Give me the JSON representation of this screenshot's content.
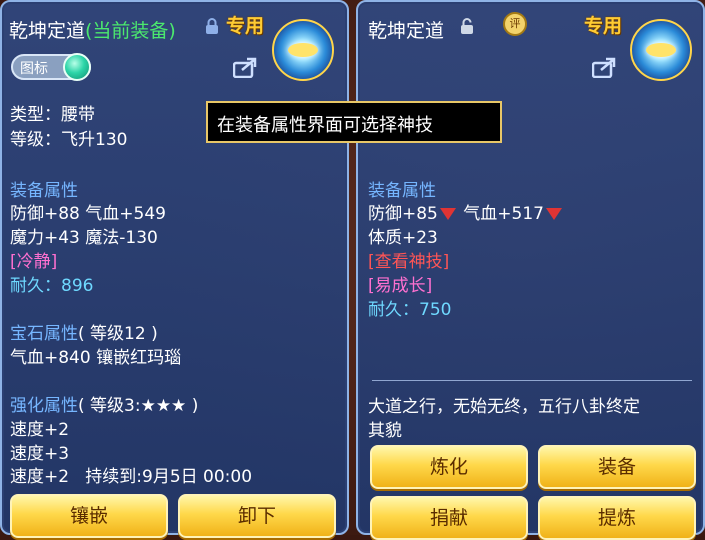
{
  "left": {
    "title_main": "乾坤定道",
    "title_status": "(当前装备)",
    "special_label": "专用",
    "icon_toggle_label": "图标",
    "type_line": "类型：腰带",
    "level_line": "等级：飞升130",
    "equip_attr_header": "装备属性",
    "attr_line1": "防御+88 气血+549",
    "attr_line2": "魔力+43 魔法-130",
    "special_tag": "[冷静]",
    "durability": "耐久：896",
    "gem_header": "宝石属性",
    "gem_level": "( 等级12 )",
    "gem_line": "气血+840 镶嵌红玛瑙",
    "enhance_header": "强化属性",
    "enhance_level": "( 等级3:★★★ )",
    "enhance_line1": "速度+2",
    "enhance_line2": "速度+3",
    "enhance_line3": "速度+2   持续到:9月5日 00:00",
    "btn_inlay": "镶嵌",
    "btn_unequip": "卸下"
  },
  "right": {
    "title_main": "乾坤定道",
    "review_badge": "评",
    "special_label": "专用",
    "attr_header": "装备属性",
    "attr_def": "防御+85",
    "attr_hp": "气血+517",
    "attr_con": "体质+23",
    "view_skill": "[查看神技]",
    "grow_tag": "[易成长]",
    "durability": "耐久：750",
    "desc_line1": "大道之行，无始无终，五行八卦终定",
    "desc_line2": "其貌",
    "btn_refine": "炼化",
    "btn_equip": "装备",
    "btn_donate": "捐献",
    "btn_extract": "提炼"
  },
  "tooltip_text": "在装备属性界面可选择神技",
  "colors": {
    "highlight_green": "#4be86e",
    "header_blue": "#76b6ff",
    "pink": "#ff70d0",
    "cyan": "#6fd9ff",
    "red": "#ff5555",
    "button_gold": "#ffd84a"
  }
}
